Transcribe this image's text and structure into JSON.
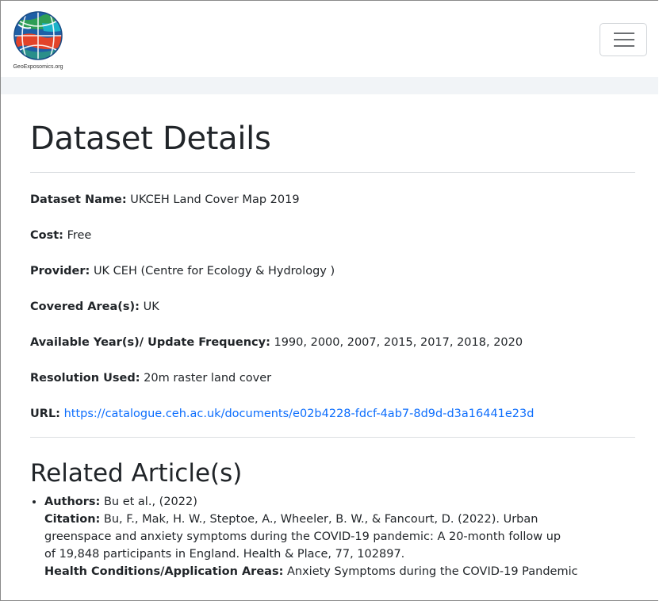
{
  "logo": {
    "text": "GeoExposomics.org",
    "icon": "globe-logo-icon"
  },
  "nav": {
    "toggler_icon": "hamburger-menu-icon"
  },
  "page": {
    "title": "Dataset Details"
  },
  "dataset": {
    "name_label": "Dataset Name:",
    "name": "UKCEH Land Cover Map 2019",
    "cost_label": "Cost:",
    "cost": "Free",
    "provider_label": "Provider:",
    "provider": "UK CEH (Centre for Ecology & Hydrology )",
    "area_label": "Covered Area(s):",
    "area": "UK",
    "years_label": "Available Year(s)/ Update Frequency:",
    "years": "1990, 2000, 2007, 2015, 2017, 2018, 2020",
    "resolution_label": "Resolution Used:",
    "resolution": "20m raster land cover",
    "url_label": "URL:",
    "url": "https://catalogue.ceh.ac.uk/documents/e02b4228-fdcf-4ab7-8d9d-d3a16441e23d"
  },
  "related": {
    "title": "Related Article(s)",
    "articles": [
      {
        "authors_label": "Authors:",
        "authors": "Bu et al., (2022)",
        "citation_label": "Citation:",
        "citation_line1": "Bu, F., Mak, H. W., Steptoe, A., Wheeler, B. W., & Fancourt, D. (2022). Urban",
        "citation_line2": "greenspace and anxiety symptoms during the COVID-19 pandemic: A 20-month follow up",
        "citation_line3": "of 19,848 participants in England. Health & Place, 77, 102897.",
        "conditions_label": "Health Conditions/Application Areas:",
        "conditions": "Anxiety Symptoms during the COVID-19 Pandemic"
      }
    ]
  },
  "colors": {
    "link": "#0d6efd",
    "nav_strip": "#f1f4f7",
    "text": "#212529"
  }
}
